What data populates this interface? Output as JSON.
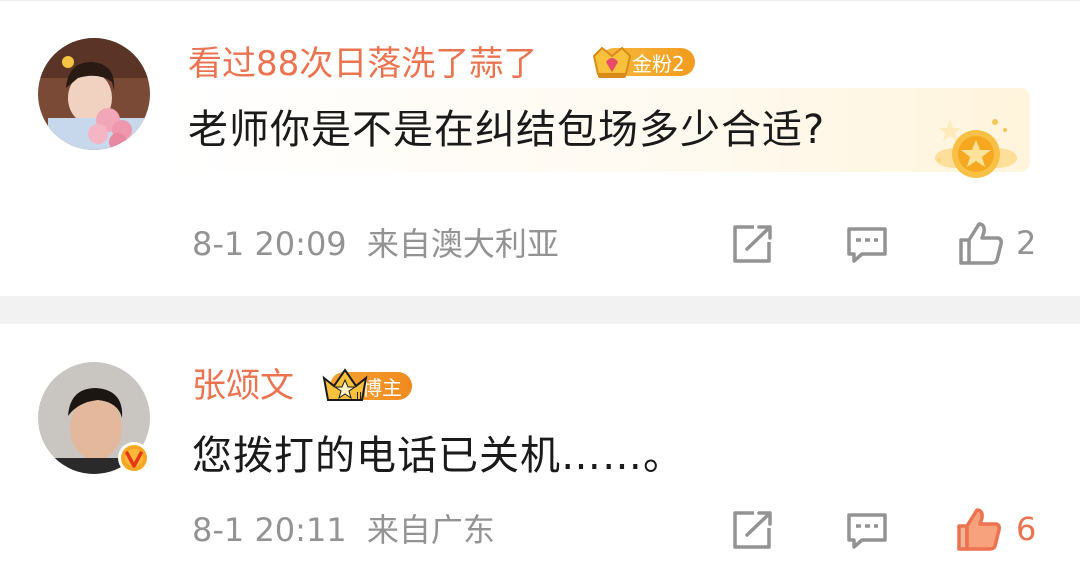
{
  "comments": [
    {
      "username": "看过88次日落洗了蒜了",
      "badge": {
        "label": "金粉2",
        "icon": "gold-fan-crown-icon",
        "color": "#f6b93b"
      },
      "text": "老师你是不是在纠结包场多少合适?",
      "timestamp": "8-1 20:09",
      "location": "来自澳大利亚",
      "like_count": "2",
      "liked": false,
      "decoration": "star-medal-icon"
    },
    {
      "username": "张颂文",
      "badge": {
        "label": "博主",
        "icon": "blogger-crown-icon",
        "color": "#f08a1e"
      },
      "verified": "verified-v-icon",
      "text": "您拨打的电话已关机……。",
      "timestamp": "8-1 20:11",
      "location": "来自广东",
      "like_count": "6",
      "liked": true
    }
  ],
  "colors": {
    "username": "#eb7350",
    "meta": "#939393",
    "liked": "#eb7350",
    "divider": "#f2f2f2"
  }
}
